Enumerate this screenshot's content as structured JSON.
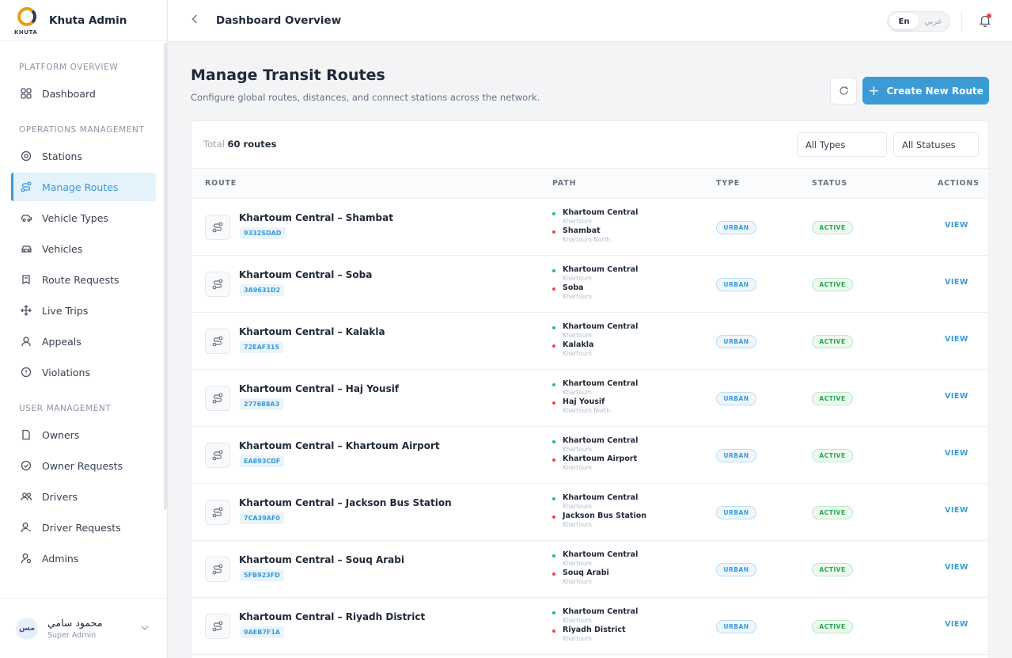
{
  "app": {
    "brand_name": "Khuta Admin",
    "logo_text": "KHUTA"
  },
  "sidebar": {
    "sections": [
      {
        "title": "PLATFORM OVERVIEW",
        "items": [
          {
            "label": "Dashboard",
            "icon": "grid-icon"
          }
        ]
      },
      {
        "title": "OPERATIONS MANAGEMENT",
        "items": [
          {
            "label": "Stations",
            "icon": "map-pin-icon"
          },
          {
            "label": "Manage Routes",
            "icon": "route-icon",
            "active": true
          },
          {
            "label": "Vehicle Types",
            "icon": "car-icon"
          },
          {
            "label": "Vehicles",
            "icon": "car-front-icon"
          },
          {
            "label": "Route Requests",
            "icon": "request-icon"
          },
          {
            "label": "Live Trips",
            "icon": "move-icon"
          },
          {
            "label": "Appeals",
            "icon": "appeal-icon"
          },
          {
            "label": "Violations",
            "icon": "alert-icon"
          }
        ]
      },
      {
        "title": "USER MANAGEMENT",
        "items": [
          {
            "label": "Owners",
            "icon": "document-icon"
          },
          {
            "label": "Owner Requests",
            "icon": "check-circle-icon"
          },
          {
            "label": "Drivers",
            "icon": "users-icon"
          },
          {
            "label": "Driver Requests",
            "icon": "user-icon"
          },
          {
            "label": "Admins",
            "icon": "user-shield-icon"
          }
        ]
      }
    ],
    "user": {
      "initials": "مس",
      "name": "محمود سامي",
      "role": "Super Admin"
    }
  },
  "topbar": {
    "title": "Dashboard Overview",
    "lang_en": "En",
    "lang_ar": "عربي"
  },
  "page": {
    "title": "Manage Transit Routes",
    "subtitle": "Configure global routes, distances, and connect stations across the network.",
    "create_label": "Create New Route"
  },
  "table": {
    "total_label": "Total",
    "total_value": "60 routes",
    "filter_types": "All Types",
    "filter_statuses": "All Statuses",
    "columns": {
      "route": "ROUTE",
      "path": "PATH",
      "type": "TYPE",
      "status": "STATUS",
      "actions": "ACTIONS"
    },
    "rows": [
      {
        "name": "Khartoum Central – Shambat",
        "code": "9332SDAD",
        "from": "Khartoum Central",
        "from_city": "Khartoum",
        "to": "Shambat",
        "to_city": "Khartoum North",
        "type": "URBAN",
        "status": "ACTIVE",
        "action": "VIEW"
      },
      {
        "name": "Khartoum Central – Soba",
        "code": "3A9631D2",
        "from": "Khartoum Central",
        "from_city": "Khartoum",
        "to": "Soba",
        "to_city": "Khartoum",
        "type": "URBAN",
        "status": "ACTIVE",
        "action": "VIEW"
      },
      {
        "name": "Khartoum Central – Kalakla",
        "code": "72EAF315",
        "from": "Khartoum Central",
        "from_city": "Khartoum",
        "to": "Kalakla",
        "to_city": "Khartoum",
        "type": "URBAN",
        "status": "ACTIVE",
        "action": "VIEW"
      },
      {
        "name": "Khartoum Central – Haj Yousif",
        "code": "277688A3",
        "from": "Khartoum Central",
        "from_city": "Khartoum",
        "to": "Haj Yousif",
        "to_city": "Khartoum North",
        "type": "URBAN",
        "status": "ACTIVE",
        "action": "VIEW"
      },
      {
        "name": "Khartoum Central – Khartoum Airport",
        "code": "EA893CDF",
        "from": "Khartoum Central",
        "from_city": "Khartoum",
        "to": "Khartoum Airport",
        "to_city": "Khartoum",
        "type": "URBAN",
        "status": "ACTIVE",
        "action": "VIEW"
      },
      {
        "name": "Khartoum Central – Jackson Bus Station",
        "code": "7CA39AF0",
        "from": "Khartoum Central",
        "from_city": "Khartoum",
        "to": "Jackson Bus Station",
        "to_city": "Khartoum",
        "type": "URBAN",
        "status": "ACTIVE",
        "action": "VIEW"
      },
      {
        "name": "Khartoum Central – Souq Arabi",
        "code": "5FB923FD",
        "from": "Khartoum Central",
        "from_city": "Khartoum",
        "to": "Souq Arabi",
        "to_city": "Khartoum",
        "type": "URBAN",
        "status": "ACTIVE",
        "action": "VIEW"
      },
      {
        "name": "Khartoum Central – Riyadh District",
        "code": "9AEB7F1A",
        "from": "Khartoum Central",
        "from_city": "Khartoum",
        "to": "Riyadh District",
        "to_city": "Khartoum",
        "type": "URBAN",
        "status": "ACTIVE",
        "action": "VIEW"
      }
    ]
  },
  "colors": {
    "accent": "#3a9bd5",
    "active_green": "#22a84a",
    "bell_dot": "#ef4444"
  }
}
